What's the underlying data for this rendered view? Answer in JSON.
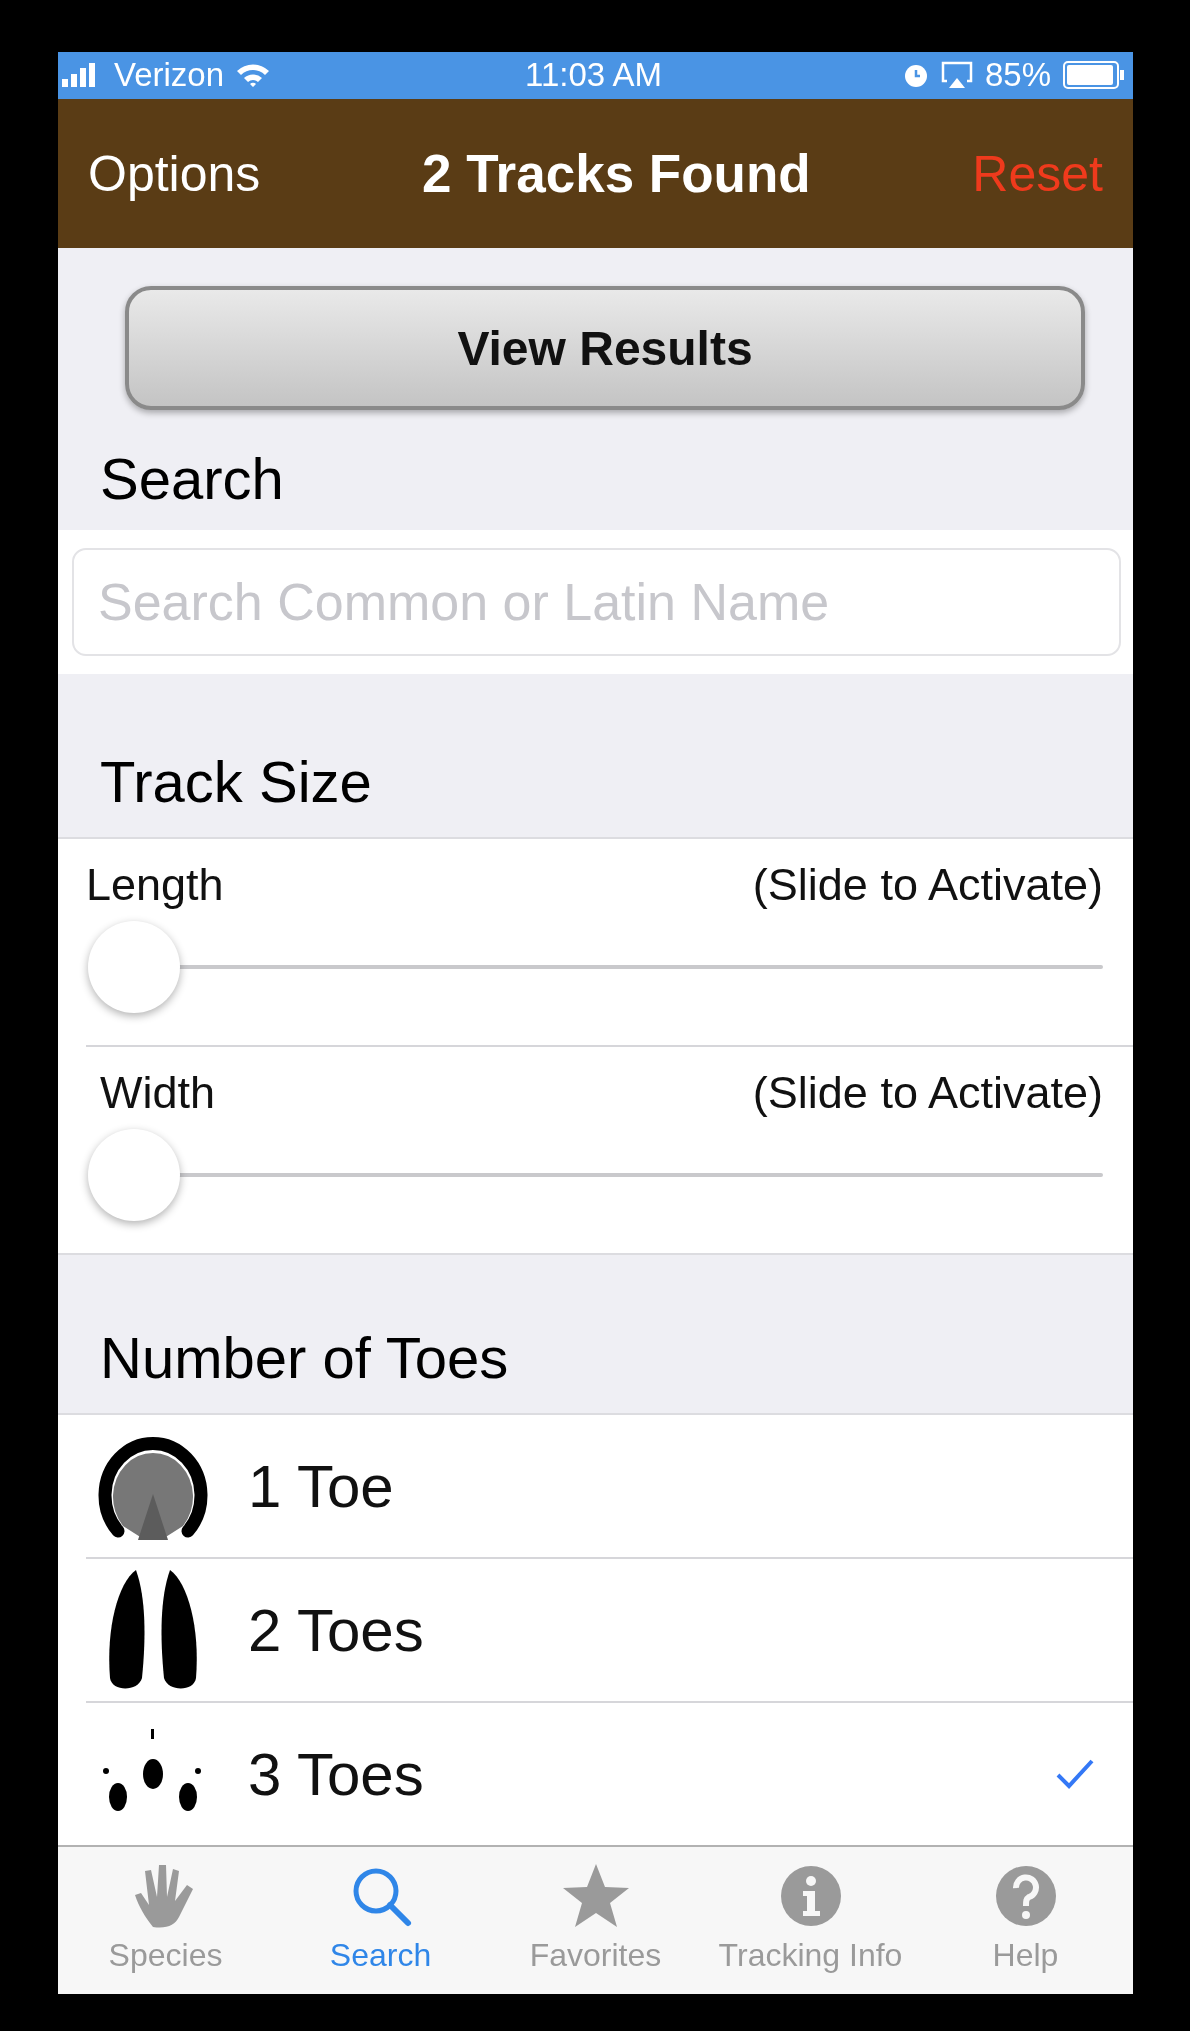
{
  "status_bar": {
    "carrier": "Verizon",
    "time": "11:03 AM",
    "battery": "85%"
  },
  "nav_bar": {
    "left": "Options",
    "title": "2 Tracks Found",
    "right": "Reset"
  },
  "view_results_button": "View Results",
  "search": {
    "heading": "Search",
    "placeholder": "Search Common or Latin Name"
  },
  "track_size": {
    "heading": "Track Size",
    "sliders": [
      {
        "label": "Length",
        "hint": "(Slide to Activate)",
        "level": 0
      },
      {
        "label": "Width",
        "hint": "(Slide to Activate)",
        "level": 0
      }
    ]
  },
  "toes": {
    "heading": "Number of Toes",
    "items": [
      {
        "label": "1 Toe",
        "kind": "hoof",
        "selected": false
      },
      {
        "label": "2 Toes",
        "kind": "cloven",
        "selected": false
      },
      {
        "label": "3 Toes",
        "kind": "three",
        "selected": true
      }
    ]
  },
  "tab_bar": [
    {
      "label": "Species",
      "kind": "hand",
      "selected": false
    },
    {
      "label": "Search",
      "kind": "search",
      "selected": true
    },
    {
      "label": "Favorites",
      "kind": "star",
      "selected": false
    },
    {
      "label": "Tracking Info",
      "kind": "info",
      "selected": false
    },
    {
      "label": "Help",
      "kind": "help",
      "selected": false
    }
  ]
}
